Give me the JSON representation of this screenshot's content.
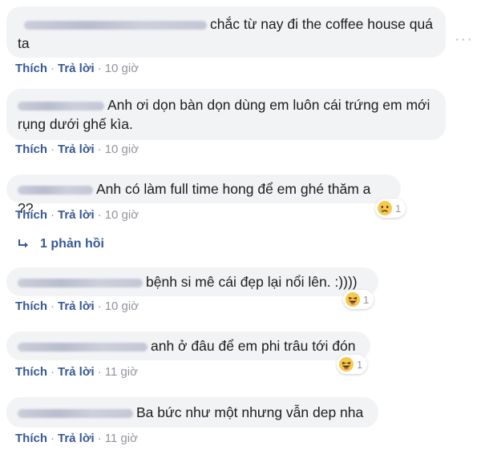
{
  "comments": [
    {
      "text": "chắc từ nay đi the coffee house quá ta",
      "like_label": "Thích",
      "reply_label": "Trả lời",
      "time": "10 giờ"
    },
    {
      "text": "Anh ơi dọn bàn dọn dùng em luôn cái trứng em mới rụng dưới ghế kìa.",
      "like_label": "Thích",
      "reply_label": "Trả lời",
      "time": "10 giờ"
    },
    {
      "text": "Anh có làm full time hong để em ghé thăm a ??",
      "like_label": "Thích",
      "reply_label": "Trả lời",
      "time": "10 giờ",
      "reaction": {
        "icon": "sad-face-icon",
        "count": "1"
      }
    },
    {
      "text": "bệnh si mê cái đẹp lại nổi lên. :))))",
      "like_label": "Thích",
      "reply_label": "Trả lời",
      "time": "10 giờ",
      "reaction": {
        "icon": "laughing-face-icon",
        "count": "1"
      }
    },
    {
      "text": "anh ở đâu để em phi trâu tới đón",
      "like_label": "Thích",
      "reply_label": "Trả lời",
      "time": "11 giờ",
      "reaction": {
        "icon": "laughing-face-icon",
        "count": "1"
      }
    },
    {
      "text": "Ba bức như một nhưng vẫn dep nha",
      "like_label": "Thích",
      "reply_label": "Trả lời",
      "time": "11 giờ"
    }
  ],
  "replies_link": {
    "icon": "reply-arrow-icon",
    "label": "1 phản hồi"
  },
  "more_options": {
    "icon": "more-options-icon",
    "label": "···"
  },
  "colors": {
    "bubble": "#f2f3f5",
    "link": "#385898",
    "meta": "#90949c",
    "text": "#1c1e21"
  }
}
